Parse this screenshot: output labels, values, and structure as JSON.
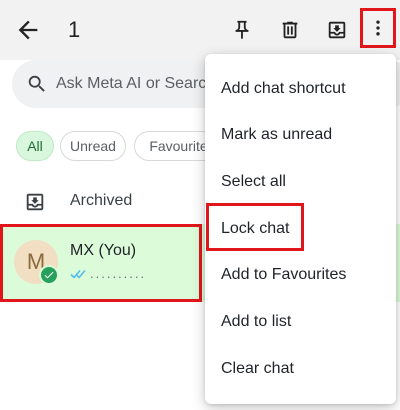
{
  "appbar": {
    "selected_count": "1",
    "icons": [
      "back-arrow-icon",
      "pin-icon",
      "delete-icon",
      "archive-icon",
      "more-vert-icon"
    ]
  },
  "search": {
    "placeholder": "Ask Meta AI or Search"
  },
  "filters": [
    {
      "label": "All",
      "selected": true
    },
    {
      "label": "Unread",
      "selected": false
    },
    {
      "label": "Favourites",
      "selected": false
    }
  ],
  "archived": {
    "label": "Archived"
  },
  "chat": {
    "avatar_initial": "M",
    "name": "MX (You)",
    "preview": "..........",
    "status": "read"
  },
  "menu": {
    "items": [
      "Add chat shortcut",
      "Mark as unread",
      "Select all",
      "Lock chat",
      "Add to Favourites",
      "Add to list",
      "Clear chat"
    ]
  },
  "colors": {
    "highlight_red": "#e0161b",
    "selected_row_bg": "#dcfbd9",
    "chip_selected_bg": "#d8f7dd",
    "check_badge": "#26a05a",
    "read_ticks": "#53bdeb"
  }
}
